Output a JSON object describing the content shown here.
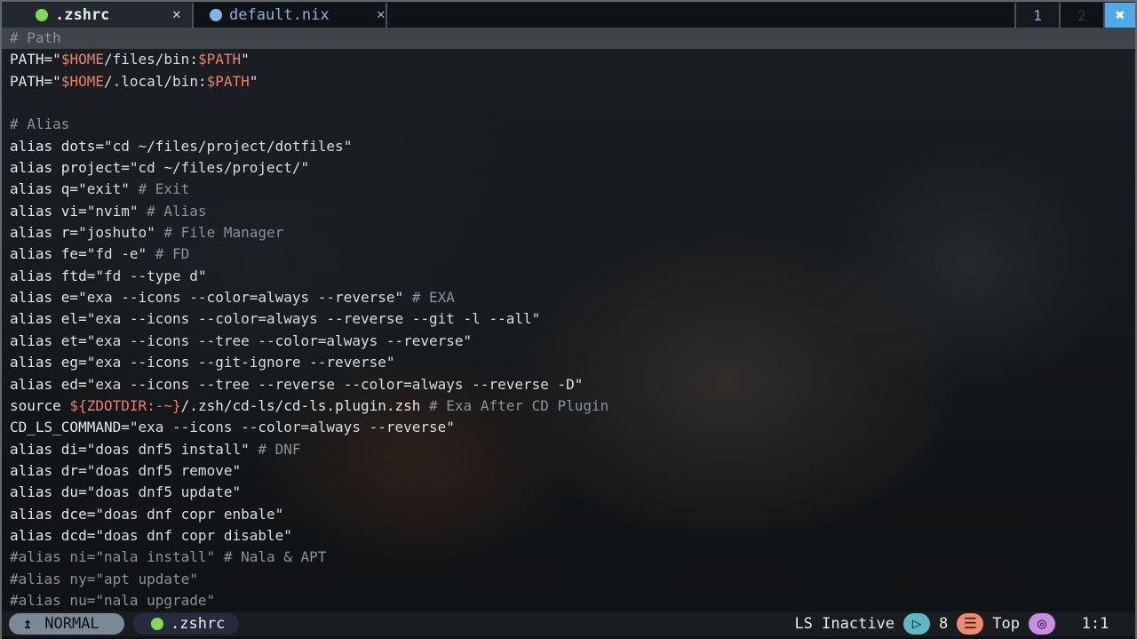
{
  "tabs": [
    {
      "label": ".zshrc",
      "dot_color": "#7ed957",
      "active": true,
      "close": "✕"
    },
    {
      "label": "default.nix",
      "dot_color": "#7fb5e6",
      "active": false,
      "close": "✕"
    }
  ],
  "tab_numbers": [
    "1",
    "2"
  ],
  "tab_close_all": "✖",
  "status": {
    "mode": "NORMAL",
    "mode_icon": "↥",
    "file": ".zshrc",
    "lsp": "LS Inactive",
    "count": "8",
    "scroll": "Top",
    "position": "1:1",
    "play_icon": "▷",
    "list_icon": "☰",
    "target_icon": "◎"
  },
  "colors": {
    "background": "#16191c",
    "cursorline": "#3f4449",
    "comment": "#8a9399",
    "variable": "#ef7e6a",
    "accent": "#4fa9e8"
  },
  "code": [
    [
      {
        "t": "# Path",
        "c": "c"
      }
    ],
    [
      {
        "t": "PATH=",
        "c": "k"
      },
      {
        "t": "\"",
        "c": "s"
      },
      {
        "t": "$HOME",
        "c": "v"
      },
      {
        "t": "/files/bin:",
        "c": "s"
      },
      {
        "t": "$PATH",
        "c": "v"
      },
      {
        "t": "\"",
        "c": "s"
      }
    ],
    [
      {
        "t": "PATH=",
        "c": "k"
      },
      {
        "t": "\"",
        "c": "s"
      },
      {
        "t": "$HOME",
        "c": "v"
      },
      {
        "t": "/.local/bin:",
        "c": "s"
      },
      {
        "t": "$PATH",
        "c": "v"
      },
      {
        "t": "\"",
        "c": "s"
      }
    ],
    [],
    [
      {
        "t": "# Alias",
        "c": "c"
      }
    ],
    [
      {
        "t": "alias ",
        "c": "k"
      },
      {
        "t": "dots=",
        "c": "k"
      },
      {
        "t": "\"cd ~/files/project/dotfiles\"",
        "c": "s"
      }
    ],
    [
      {
        "t": "alias ",
        "c": "k"
      },
      {
        "t": "project=",
        "c": "k"
      },
      {
        "t": "\"cd ~/files/project/\"",
        "c": "s"
      }
    ],
    [
      {
        "t": "alias ",
        "c": "k"
      },
      {
        "t": "q=",
        "c": "k"
      },
      {
        "t": "\"exit\"",
        "c": "s"
      },
      {
        "t": " # Exit",
        "c": "c"
      }
    ],
    [
      {
        "t": "alias ",
        "c": "k"
      },
      {
        "t": "vi=",
        "c": "k"
      },
      {
        "t": "\"nvim\"",
        "c": "s"
      },
      {
        "t": " # Alias",
        "c": "c"
      }
    ],
    [
      {
        "t": "alias ",
        "c": "k"
      },
      {
        "t": "r=",
        "c": "k"
      },
      {
        "t": "\"joshuto\"",
        "c": "s"
      },
      {
        "t": " # File Manager",
        "c": "c"
      }
    ],
    [
      {
        "t": "alias ",
        "c": "k"
      },
      {
        "t": "fe=",
        "c": "k"
      },
      {
        "t": "\"fd -e\"",
        "c": "s"
      },
      {
        "t": " # FD",
        "c": "c"
      }
    ],
    [
      {
        "t": "alias ",
        "c": "k"
      },
      {
        "t": "ftd=",
        "c": "k"
      },
      {
        "t": "\"fd --type d\"",
        "c": "s"
      }
    ],
    [
      {
        "t": "alias ",
        "c": "k"
      },
      {
        "t": "e=",
        "c": "k"
      },
      {
        "t": "\"exa --icons --color=always --reverse\"",
        "c": "s"
      },
      {
        "t": " # EXA",
        "c": "c"
      }
    ],
    [
      {
        "t": "alias ",
        "c": "k"
      },
      {
        "t": "el=",
        "c": "k"
      },
      {
        "t": "\"exa --icons --color=always --reverse --git -l --all\"",
        "c": "s"
      }
    ],
    [
      {
        "t": "alias ",
        "c": "k"
      },
      {
        "t": "et=",
        "c": "k"
      },
      {
        "t": "\"exa --icons --tree --color=always --reverse\"",
        "c": "s"
      }
    ],
    [
      {
        "t": "alias ",
        "c": "k"
      },
      {
        "t": "eg=",
        "c": "k"
      },
      {
        "t": "\"exa --icons --git-ignore --reverse\"",
        "c": "s"
      }
    ],
    [
      {
        "t": "alias ",
        "c": "k"
      },
      {
        "t": "ed=",
        "c": "k"
      },
      {
        "t": "\"exa --icons --tree --reverse --color=always --reverse -D\"",
        "c": "s"
      }
    ],
    [
      {
        "t": "source ",
        "c": "k"
      },
      {
        "t": "${ZDOTDIR:-~}",
        "c": "v"
      },
      {
        "t": "/.zsh/cd-ls/cd-ls.plugin.zsh",
        "c": "k"
      },
      {
        "t": " # Exa After CD Plugin",
        "c": "c"
      }
    ],
    [
      {
        "t": "CD_LS_COMMAND=",
        "c": "k"
      },
      {
        "t": "\"exa --icons --color=always --reverse\"",
        "c": "s"
      }
    ],
    [
      {
        "t": "alias ",
        "c": "k"
      },
      {
        "t": "di=",
        "c": "k"
      },
      {
        "t": "\"doas dnf5 install\"",
        "c": "s"
      },
      {
        "t": " # DNF",
        "c": "c"
      }
    ],
    [
      {
        "t": "alias ",
        "c": "k"
      },
      {
        "t": "dr=",
        "c": "k"
      },
      {
        "t": "\"doas dnf5 remove\"",
        "c": "s"
      }
    ],
    [
      {
        "t": "alias ",
        "c": "k"
      },
      {
        "t": "du=",
        "c": "k"
      },
      {
        "t": "\"doas dnf5 update\"",
        "c": "s"
      }
    ],
    [
      {
        "t": "alias ",
        "c": "k"
      },
      {
        "t": "dce=",
        "c": "k"
      },
      {
        "t": "\"doas dnf copr enbale\"",
        "c": "s"
      }
    ],
    [
      {
        "t": "alias ",
        "c": "k"
      },
      {
        "t": "dcd=",
        "c": "k"
      },
      {
        "t": "\"doas dnf copr disable\"",
        "c": "s"
      }
    ],
    [
      {
        "t": "#alias ni=\"nala install\" # Nala & APT",
        "c": "c"
      }
    ],
    [
      {
        "t": "#alias ny=\"apt update\"",
        "c": "c"
      }
    ],
    [
      {
        "t": "#alias nu=\"nala upgrade\"",
        "c": "c"
      }
    ]
  ]
}
